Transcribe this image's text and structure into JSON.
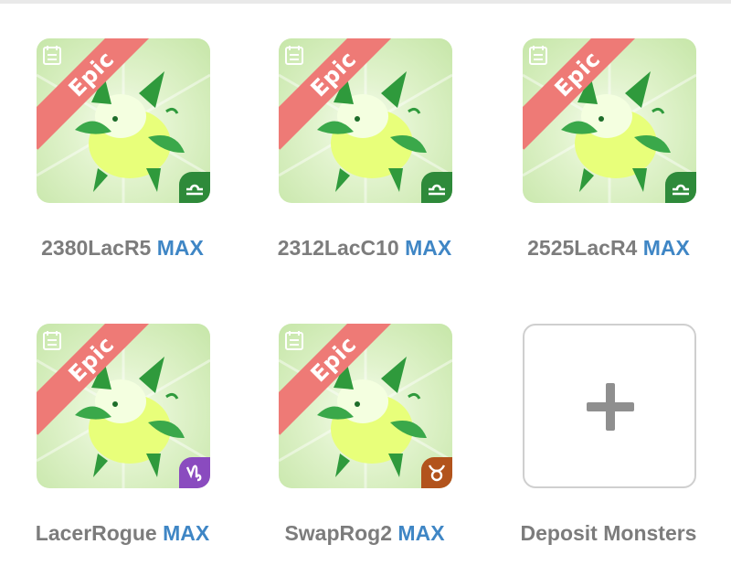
{
  "monsters": [
    {
      "name": "2380LacR5",
      "level_tag": "MAX",
      "rarity": "Epic",
      "zodiac": "libra",
      "zodiac_color": "#2e8a3a"
    },
    {
      "name": "2312LacC10",
      "level_tag": "MAX",
      "rarity": "Epic",
      "zodiac": "libra",
      "zodiac_color": "#2e8a3a"
    },
    {
      "name": "2525LacR4",
      "level_tag": "MAX",
      "rarity": "Epic",
      "zodiac": "libra",
      "zodiac_color": "#2e8a3a"
    },
    {
      "name": "LacerRogue",
      "level_tag": "MAX",
      "rarity": "Epic",
      "zodiac": "capricorn",
      "zodiac_color": "#8a4bbf"
    },
    {
      "name": "SwapRog2",
      "level_tag": "MAX",
      "rarity": "Epic",
      "zodiac": "taurus",
      "zodiac_color": "#b2531c"
    }
  ],
  "deposit": {
    "label": "Deposit Monsters",
    "icon": "plus-icon"
  },
  "colors": {
    "max_tag": "#3f86c5",
    "epic_ribbon": "#ee7a76",
    "label_text": "#7c7c7c"
  },
  "icons": {
    "corner": "calendar-icon"
  }
}
